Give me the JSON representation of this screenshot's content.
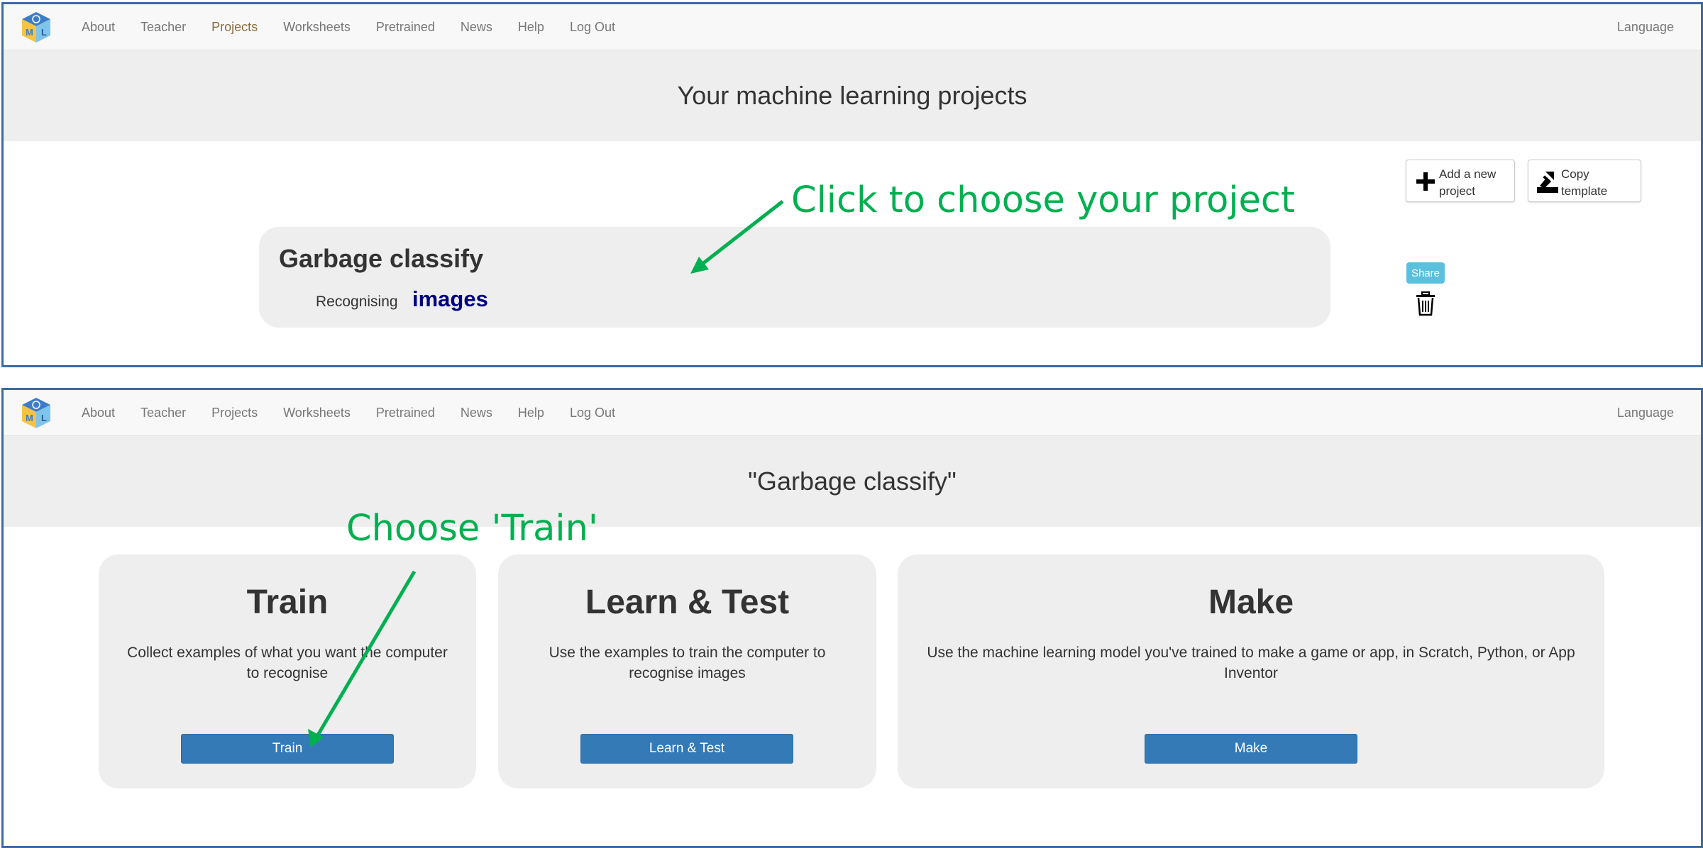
{
  "nav": {
    "items": [
      "About",
      "Teacher",
      "Projects",
      "Worksheets",
      "Pretrained",
      "News",
      "Help",
      "Log Out"
    ],
    "language": "Language",
    "logo_letters": [
      "M",
      "L"
    ]
  },
  "projects_page": {
    "heading": "Your machine learning projects",
    "add_project": "Add a new project",
    "copy_template": "Copy template",
    "project": {
      "name": "Garbage classify",
      "type_label": "Recognising",
      "type": "images"
    },
    "share": "Share",
    "annotation": "Click to choose your project"
  },
  "project_page": {
    "heading": "\"Garbage classify\"",
    "annotation": "Choose 'Train'",
    "stages": [
      {
        "title": "Train",
        "description": "Collect examples of what you want the computer to recognise",
        "button": "Train"
      },
      {
        "title": "Learn & Test",
        "description": "Use the examples to train the computer to recognise images",
        "button": "Learn & Test"
      },
      {
        "title": "Make",
        "description": "Use the machine learning model you've trained to make a game or app, in Scratch, Python, or App Inventor",
        "button": "Make"
      }
    ]
  },
  "colors": {
    "annotation": "#00b050",
    "primary_button": "#337ab7",
    "share_button": "#5bc0de",
    "project_type": "#000080",
    "frame_border": "#3d6aa0"
  },
  "icons": [
    "logo-cube-icon",
    "plus-icon",
    "copy-template-icon",
    "trash-icon",
    "arrow-annotation"
  ]
}
